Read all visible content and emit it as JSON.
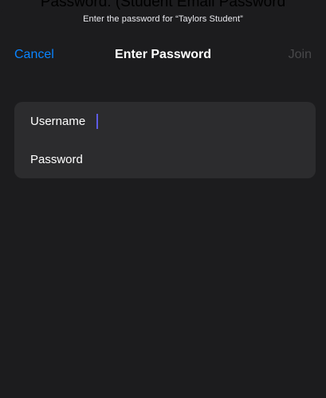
{
  "caption": "Password: (Student Email Password",
  "prompt": "Enter the password for “Taylors Student”",
  "navbar": {
    "cancel_label": "Cancel",
    "title": "Enter Password",
    "join_label": "Join"
  },
  "form": {
    "username_label": "Username",
    "username_value": "",
    "password_label": "Password",
    "password_value": ""
  },
  "colors": {
    "background": "#1c1c1e",
    "group_background": "#2c2c2e",
    "accent": "#0a84ff",
    "disabled": "#48484a",
    "caret": "#5e5ce6"
  }
}
